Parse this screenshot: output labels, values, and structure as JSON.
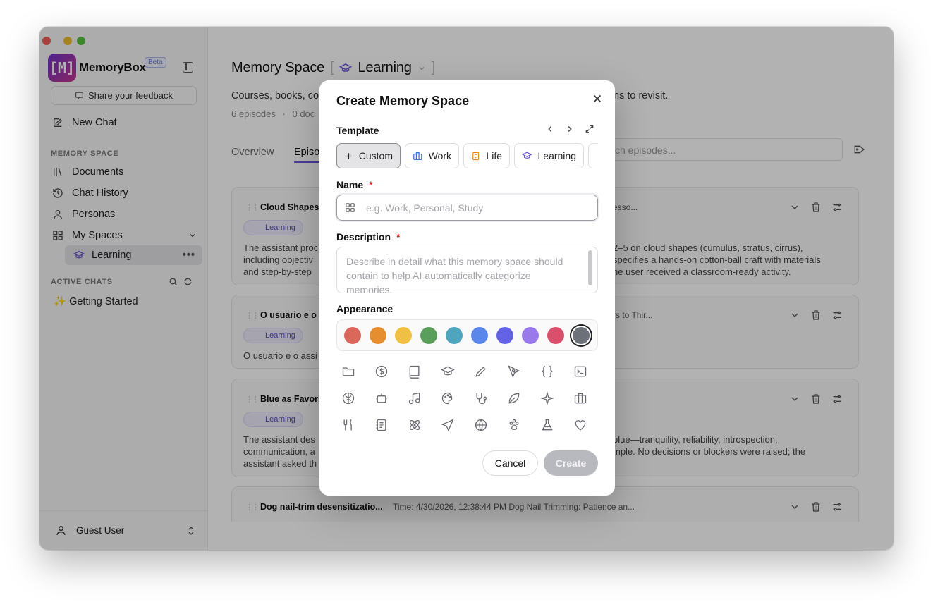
{
  "window_controls": [
    "close",
    "minimize",
    "zoom"
  ],
  "sidebar": {
    "brand": "MemoryBox",
    "beta_badge": "Beta",
    "feedback": "Share your feedback",
    "new_chat": "New Chat",
    "memory_section": "MEMORY SPACE",
    "items": [
      {
        "label": "Documents",
        "icon": "books-icon"
      },
      {
        "label": "Chat History",
        "icon": "history-icon"
      },
      {
        "label": "Personas",
        "icon": "person-icon"
      },
      {
        "label": "My Spaces",
        "icon": "grid-icon"
      }
    ],
    "space_item": "Learning",
    "active_chats_section": "ACTIVE CHATS",
    "chats": [
      "✨ Getting Started"
    ],
    "user": "Guest User"
  },
  "main": {
    "heading": "Memory Space",
    "space_name": "Learning",
    "subtitle_left": "Courses, books, co",
    "subtitle_right": "ns to revisit.",
    "meta_episodes": "6 episodes",
    "meta_docs": "0 doc",
    "tabs": [
      "Overview",
      "Episo"
    ],
    "search_placeholder": "ch episodes...",
    "cards": [
      {
        "title": "Cloud Shapes",
        "badge": "Learning",
        "right": "esso...",
        "body_left": [
          "The assistant proc",
          "including objectiv",
          "and step-by-step"
        ],
        "body_right": [
          "2–5 on cloud shapes (cumulus, stratus, cirrus),",
          "specifies a hands-on cotton-ball craft with materials",
          "he user received a classroom-ready activity."
        ]
      },
      {
        "title": "O usuario e o a",
        "badge": "Learning",
        "right": "rs to Thir...",
        "body_left": [
          "O usuario e o assi"
        ],
        "body_right": []
      },
      {
        "title": "Blue as Favorit",
        "badge": "Learning",
        "right": "",
        "body_left": [
          "The assistant des",
          "communication, a",
          "assistant asked th"
        ],
        "body_right": [
          "blue—tranquility, reliability, introspection,",
          "mple. No decisions or blockers were raised; the"
        ]
      },
      {
        "title": "Dog nail-trim desensitizatio...",
        "badge": "Learning",
        "right": "Time: 4/30/2026, 12:38:44 PM    Dog Nail Trimming: Patience an...",
        "body_left": [],
        "body_right": []
      }
    ]
  },
  "modal": {
    "title": "Create Memory Space",
    "template_label": "Template",
    "templates": [
      {
        "label": "Custom",
        "icon": "plus-icon",
        "color": "#222222"
      },
      {
        "label": "Work",
        "icon": "briefcase-icon",
        "color": "#3b6fd4"
      },
      {
        "label": "Life",
        "icon": "notebook-icon",
        "color": "#e08a1e"
      },
      {
        "label": "Learning",
        "icon": "graduation-cap-icon",
        "color": "#6b55d6"
      }
    ],
    "name_label": "Name",
    "required_mark": "*",
    "name_placeholder": "e.g. Work, Personal, Study",
    "description_label": "Description",
    "description_placeholder": "Describe in detail what this memory space should contain to help AI automatically categorize memories.",
    "appearance_label": "Appearance",
    "colors": [
      "#d9675a",
      "#e58e2f",
      "#f0bf45",
      "#5a9e5b",
      "#4fa5bd",
      "#5b87ea",
      "#6463e6",
      "#9a7ae8",
      "#d8506b",
      "#6c7079"
    ],
    "selected_color": "#6c7079",
    "icons": [
      "folder-icon",
      "dollar-icon",
      "book-icon",
      "graduation-cap-icon",
      "pencil-icon",
      "pen-tool-icon",
      "braces-icon",
      "terminal-icon",
      "brain-icon",
      "robot-icon",
      "music-icon",
      "palette-icon",
      "stethoscope-icon",
      "leaf-icon",
      "sparkle-icon",
      "briefcase-icon",
      "utensils-icon",
      "notebook-icon",
      "atom-icon",
      "plane-icon",
      "globe-icon",
      "paw-icon",
      "flask-icon",
      "heart-icon"
    ],
    "cancel": "Cancel",
    "create": "Create"
  }
}
